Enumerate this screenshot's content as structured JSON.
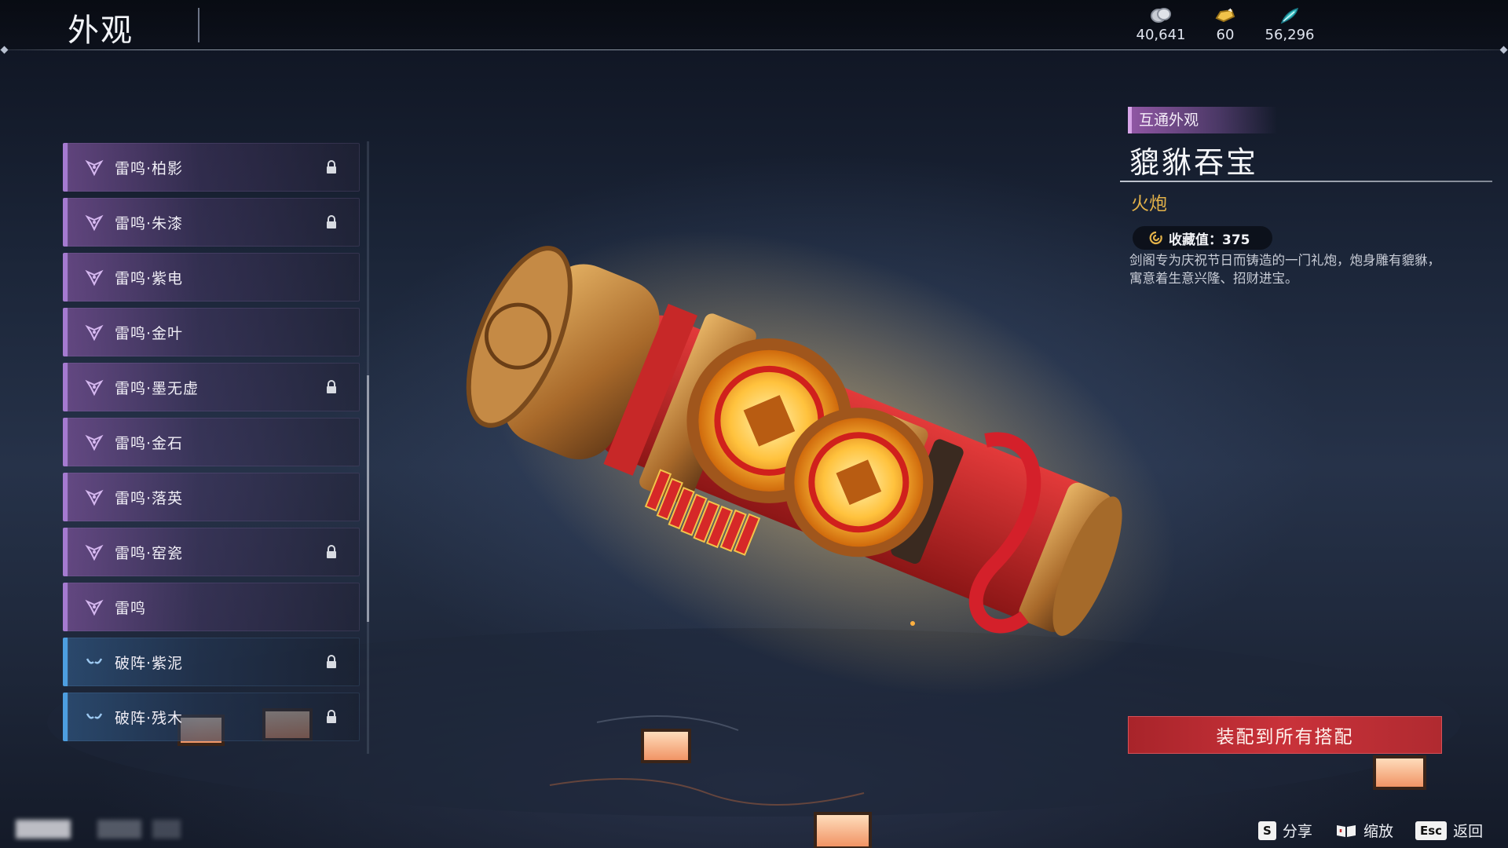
{
  "header": {
    "title": "外观",
    "currencies": [
      {
        "icon": "silver-coin-icon",
        "value": "40,641"
      },
      {
        "icon": "gold-ingot-icon",
        "value": "60"
      },
      {
        "icon": "jade-feather-icon",
        "value": "56,296"
      }
    ]
  },
  "list": {
    "items": [
      {
        "label": "雷鸣·柏影",
        "locked": true,
        "rarity": "purple"
      },
      {
        "label": "雷鸣·朱漆",
        "locked": true,
        "rarity": "purple"
      },
      {
        "label": "雷鸣·紫电",
        "locked": false,
        "rarity": "purple"
      },
      {
        "label": "雷鸣·金叶",
        "locked": false,
        "rarity": "purple"
      },
      {
        "label": "雷鸣·墨无虚",
        "locked": true,
        "rarity": "purple"
      },
      {
        "label": "雷鸣·金石",
        "locked": false,
        "rarity": "purple"
      },
      {
        "label": "雷鸣·落英",
        "locked": false,
        "rarity": "purple"
      },
      {
        "label": "雷鸣·窑瓷",
        "locked": true,
        "rarity": "purple"
      },
      {
        "label": "雷鸣",
        "locked": false,
        "rarity": "purple"
      },
      {
        "label": "破阵·紫泥",
        "locked": true,
        "rarity": "blue"
      },
      {
        "label": "破阵·残木",
        "locked": true,
        "rarity": "blue"
      }
    ]
  },
  "detail": {
    "tag": "互通外观",
    "name": "貔貅吞宝",
    "type": "火炮",
    "collect_label": "收藏值：375",
    "description": "剑阁专为庆祝节日而铸造的一门礼炮，炮身雕有貔貅，寓意着生意兴隆、招财进宝。",
    "equip_button": "装配到所有搭配"
  },
  "hints": [
    {
      "key": "S",
      "label": "分享"
    },
    {
      "key": "",
      "icon": "book-icon",
      "label": "缩放"
    },
    {
      "key": "Esc",
      "label": "返回"
    }
  ],
  "colors": {
    "purple_rarity": "#a57ad0",
    "blue_rarity": "#4d9ee0",
    "accent_gold": "#e3b249",
    "equip_red": "#c9323a"
  }
}
